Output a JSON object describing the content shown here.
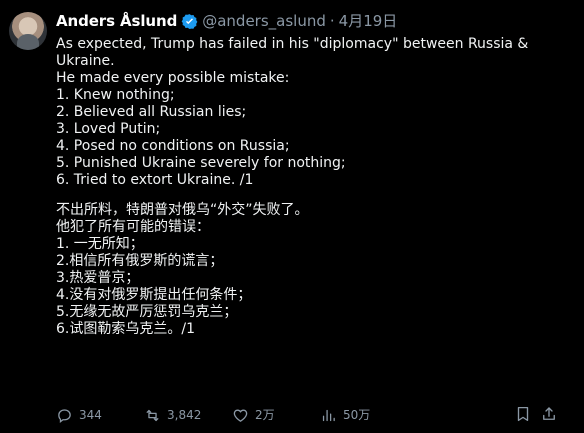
{
  "author": {
    "name": "Anders Åslund",
    "handle": "@anders_aslund",
    "separator": "·",
    "date": "4月19日"
  },
  "post": {
    "english_lines": [
      "As expected, Trump has failed in his \"diplomacy\" between Russia &",
      "Ukraine.",
      "He made every possible mistake:",
      "1. Knew nothing;",
      "2. Believed all Russian lies;",
      "3. Loved Putin;",
      "4. Posed no conditions on Russia;",
      "5. Punished Ukraine severely for nothing;",
      "6. Tried to extort Ukraine. /1"
    ],
    "chinese_lines": [
      "不出所料，特朗普对俄乌“外交”失败了。",
      "他犯了所有可能的错误：",
      "1. 一无所知；",
      "2.相信所有俄罗斯的谎言；",
      "3.热爱普京；",
      "4.没有对俄罗斯提出任何条件；",
      "5.无缘无故严厉惩罚乌克兰；",
      "6.试图勒索乌克兰。/1"
    ]
  },
  "actions": {
    "replies": "344",
    "reposts": "3,842",
    "likes": "2万",
    "views": "50万"
  },
  "icons": {
    "verified": "verified-badge-icon",
    "reply": "reply-icon",
    "repost": "repost-icon",
    "like": "heart-icon",
    "views": "views-chart-icon",
    "bookmark": "bookmark-icon",
    "share": "share-icon"
  },
  "colors": {
    "background": "#000000",
    "text": "#e7e9ea",
    "muted": "#8b98a5",
    "verified": "#1d9bf0"
  }
}
